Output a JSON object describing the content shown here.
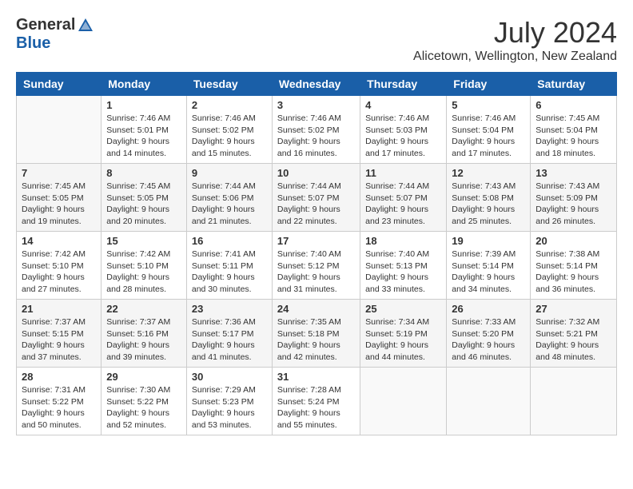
{
  "logo": {
    "general": "General",
    "blue": "Blue"
  },
  "title": "July 2024",
  "location": "Alicetown, Wellington, New Zealand",
  "days_of_week": [
    "Sunday",
    "Monday",
    "Tuesday",
    "Wednesday",
    "Thursday",
    "Friday",
    "Saturday"
  ],
  "weeks": [
    [
      {
        "day": "",
        "info": ""
      },
      {
        "day": "1",
        "info": "Sunrise: 7:46 AM\nSunset: 5:01 PM\nDaylight: 9 hours\nand 14 minutes."
      },
      {
        "day": "2",
        "info": "Sunrise: 7:46 AM\nSunset: 5:02 PM\nDaylight: 9 hours\nand 15 minutes."
      },
      {
        "day": "3",
        "info": "Sunrise: 7:46 AM\nSunset: 5:02 PM\nDaylight: 9 hours\nand 16 minutes."
      },
      {
        "day": "4",
        "info": "Sunrise: 7:46 AM\nSunset: 5:03 PM\nDaylight: 9 hours\nand 17 minutes."
      },
      {
        "day": "5",
        "info": "Sunrise: 7:46 AM\nSunset: 5:04 PM\nDaylight: 9 hours\nand 17 minutes."
      },
      {
        "day": "6",
        "info": "Sunrise: 7:45 AM\nSunset: 5:04 PM\nDaylight: 9 hours\nand 18 minutes."
      }
    ],
    [
      {
        "day": "7",
        "info": "Sunrise: 7:45 AM\nSunset: 5:05 PM\nDaylight: 9 hours\nand 19 minutes."
      },
      {
        "day": "8",
        "info": "Sunrise: 7:45 AM\nSunset: 5:05 PM\nDaylight: 9 hours\nand 20 minutes."
      },
      {
        "day": "9",
        "info": "Sunrise: 7:44 AM\nSunset: 5:06 PM\nDaylight: 9 hours\nand 21 minutes."
      },
      {
        "day": "10",
        "info": "Sunrise: 7:44 AM\nSunset: 5:07 PM\nDaylight: 9 hours\nand 22 minutes."
      },
      {
        "day": "11",
        "info": "Sunrise: 7:44 AM\nSunset: 5:07 PM\nDaylight: 9 hours\nand 23 minutes."
      },
      {
        "day": "12",
        "info": "Sunrise: 7:43 AM\nSunset: 5:08 PM\nDaylight: 9 hours\nand 25 minutes."
      },
      {
        "day": "13",
        "info": "Sunrise: 7:43 AM\nSunset: 5:09 PM\nDaylight: 9 hours\nand 26 minutes."
      }
    ],
    [
      {
        "day": "14",
        "info": "Sunrise: 7:42 AM\nSunset: 5:10 PM\nDaylight: 9 hours\nand 27 minutes."
      },
      {
        "day": "15",
        "info": "Sunrise: 7:42 AM\nSunset: 5:10 PM\nDaylight: 9 hours\nand 28 minutes."
      },
      {
        "day": "16",
        "info": "Sunrise: 7:41 AM\nSunset: 5:11 PM\nDaylight: 9 hours\nand 30 minutes."
      },
      {
        "day": "17",
        "info": "Sunrise: 7:40 AM\nSunset: 5:12 PM\nDaylight: 9 hours\nand 31 minutes."
      },
      {
        "day": "18",
        "info": "Sunrise: 7:40 AM\nSunset: 5:13 PM\nDaylight: 9 hours\nand 33 minutes."
      },
      {
        "day": "19",
        "info": "Sunrise: 7:39 AM\nSunset: 5:14 PM\nDaylight: 9 hours\nand 34 minutes."
      },
      {
        "day": "20",
        "info": "Sunrise: 7:38 AM\nSunset: 5:14 PM\nDaylight: 9 hours\nand 36 minutes."
      }
    ],
    [
      {
        "day": "21",
        "info": "Sunrise: 7:37 AM\nSunset: 5:15 PM\nDaylight: 9 hours\nand 37 minutes."
      },
      {
        "day": "22",
        "info": "Sunrise: 7:37 AM\nSunset: 5:16 PM\nDaylight: 9 hours\nand 39 minutes."
      },
      {
        "day": "23",
        "info": "Sunrise: 7:36 AM\nSunset: 5:17 PM\nDaylight: 9 hours\nand 41 minutes."
      },
      {
        "day": "24",
        "info": "Sunrise: 7:35 AM\nSunset: 5:18 PM\nDaylight: 9 hours\nand 42 minutes."
      },
      {
        "day": "25",
        "info": "Sunrise: 7:34 AM\nSunset: 5:19 PM\nDaylight: 9 hours\nand 44 minutes."
      },
      {
        "day": "26",
        "info": "Sunrise: 7:33 AM\nSunset: 5:20 PM\nDaylight: 9 hours\nand 46 minutes."
      },
      {
        "day": "27",
        "info": "Sunrise: 7:32 AM\nSunset: 5:21 PM\nDaylight: 9 hours\nand 48 minutes."
      }
    ],
    [
      {
        "day": "28",
        "info": "Sunrise: 7:31 AM\nSunset: 5:22 PM\nDaylight: 9 hours\nand 50 minutes."
      },
      {
        "day": "29",
        "info": "Sunrise: 7:30 AM\nSunset: 5:22 PM\nDaylight: 9 hours\nand 52 minutes."
      },
      {
        "day": "30",
        "info": "Sunrise: 7:29 AM\nSunset: 5:23 PM\nDaylight: 9 hours\nand 53 minutes."
      },
      {
        "day": "31",
        "info": "Sunrise: 7:28 AM\nSunset: 5:24 PM\nDaylight: 9 hours\nand 55 minutes."
      },
      {
        "day": "",
        "info": ""
      },
      {
        "day": "",
        "info": ""
      },
      {
        "day": "",
        "info": ""
      }
    ]
  ]
}
